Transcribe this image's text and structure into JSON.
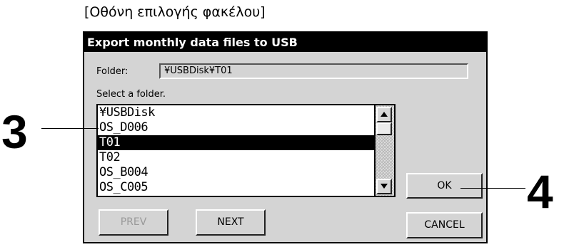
{
  "caption": "[Οθόνη επιλογής φακέλου]",
  "dialog": {
    "title": "Export monthly data files to USB",
    "folder_label": "Folder:",
    "folder_value": "¥USBDisk¥T01",
    "select_label": "Select a folder.",
    "folders": [
      {
        "label": "¥USBDisk",
        "selected": false
      },
      {
        "label": "OS_D006",
        "selected": false
      },
      {
        "label": "T01",
        "selected": true
      },
      {
        "label": "T02",
        "selected": false
      },
      {
        "label": "OS_B004",
        "selected": false
      },
      {
        "label": "OS_C005",
        "selected": false
      }
    ],
    "buttons": {
      "prev": "PREV",
      "next": "NEXT",
      "ok": "OK",
      "cancel": "CANCEL"
    }
  },
  "callouts": {
    "list": "3",
    "ok": "4"
  }
}
